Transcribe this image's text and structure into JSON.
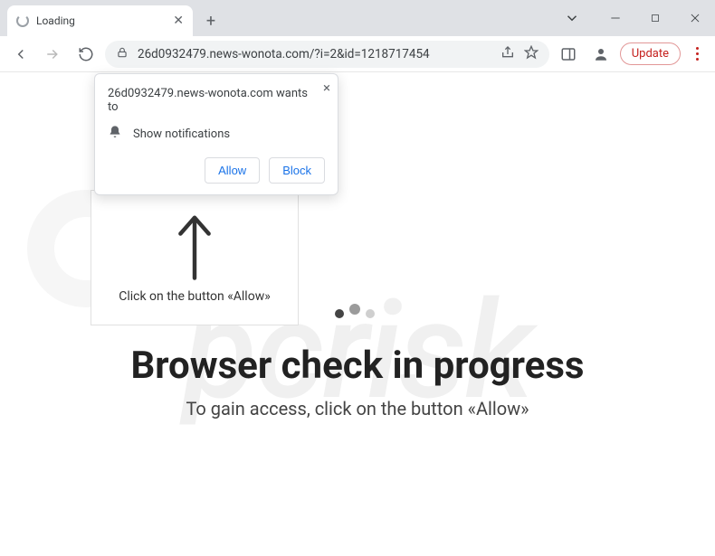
{
  "window": {
    "tab_title": "Loading",
    "url": "26d0932479.news-wonota.com/?i=2&id=1218717454",
    "update_label": "Update"
  },
  "permission": {
    "origin_wants_to": "26d0932479.news-wonota.com wants to",
    "capability": "Show notifications",
    "allow": "Allow",
    "block": "Block"
  },
  "page": {
    "card_caption": "Click on the button «Allow»",
    "headline": "Browser check in progress",
    "subline": "To gain access, click on the button «Allow»"
  },
  "watermark": {
    "text": "pcrisk"
  }
}
